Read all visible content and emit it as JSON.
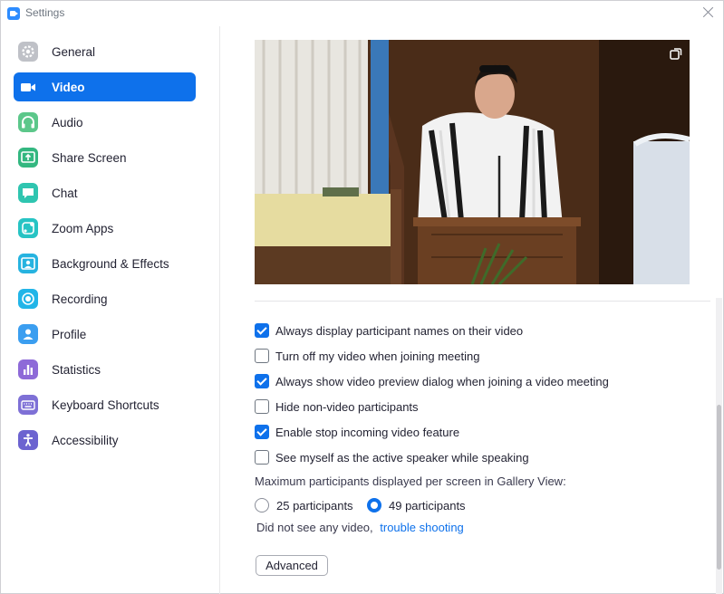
{
  "window": {
    "title": "Settings"
  },
  "sidebar": {
    "items": [
      {
        "label": "General",
        "icon": "gear-icon",
        "color": "#bfc1c7",
        "active": false
      },
      {
        "label": "Video",
        "icon": "video-camera-icon",
        "color": "#0e71eb",
        "active": true
      },
      {
        "label": "Audio",
        "icon": "headphones-icon",
        "color": "#5cc78a",
        "active": false
      },
      {
        "label": "Share Screen",
        "icon": "share-screen-icon",
        "color": "#33b780",
        "active": false
      },
      {
        "label": "Chat",
        "icon": "chat-bubble-icon",
        "color": "#2fc5b0",
        "active": false
      },
      {
        "label": "Zoom Apps",
        "icon": "zoom-apps-icon",
        "color": "#27c4c4",
        "active": false
      },
      {
        "label": "Background & Effects",
        "icon": "background-icon",
        "color": "#26b3e0",
        "active": false
      },
      {
        "label": "Recording",
        "icon": "record-icon",
        "color": "#22b5e8",
        "active": false
      },
      {
        "label": "Profile",
        "icon": "profile-icon",
        "color": "#3b9ef0",
        "active": false
      },
      {
        "label": "Statistics",
        "icon": "statistics-icon",
        "color": "#8e6ad8",
        "active": false
      },
      {
        "label": "Keyboard Shortcuts",
        "icon": "keyboard-icon",
        "color": "#7e70d6",
        "active": false
      },
      {
        "label": "Accessibility",
        "icon": "accessibility-icon",
        "color": "#6c63d0",
        "active": false
      }
    ]
  },
  "main": {
    "options": [
      {
        "label": "Always display participant names on their video",
        "checked": true
      },
      {
        "label": "Turn off my video when joining meeting",
        "checked": false
      },
      {
        "label": "Always show video preview dialog when joining a video meeting",
        "checked": true
      },
      {
        "label": "Hide non-video participants",
        "checked": false
      },
      {
        "label": "Enable stop incoming video feature",
        "checked": true
      },
      {
        "label": "See myself as the active speaker while speaking",
        "checked": false
      }
    ],
    "gallery": {
      "label": "Maximum participants displayed per screen in Gallery View:",
      "options": [
        {
          "label": "25 participants",
          "selected": false
        },
        {
          "label": "49 participants",
          "selected": true
        }
      ]
    },
    "trouble": {
      "text": "Did not see any video,",
      "link": "trouble shooting"
    },
    "advanced_label": "Advanced"
  },
  "colors": {
    "accent": "#0e71eb",
    "text": "#232333"
  }
}
